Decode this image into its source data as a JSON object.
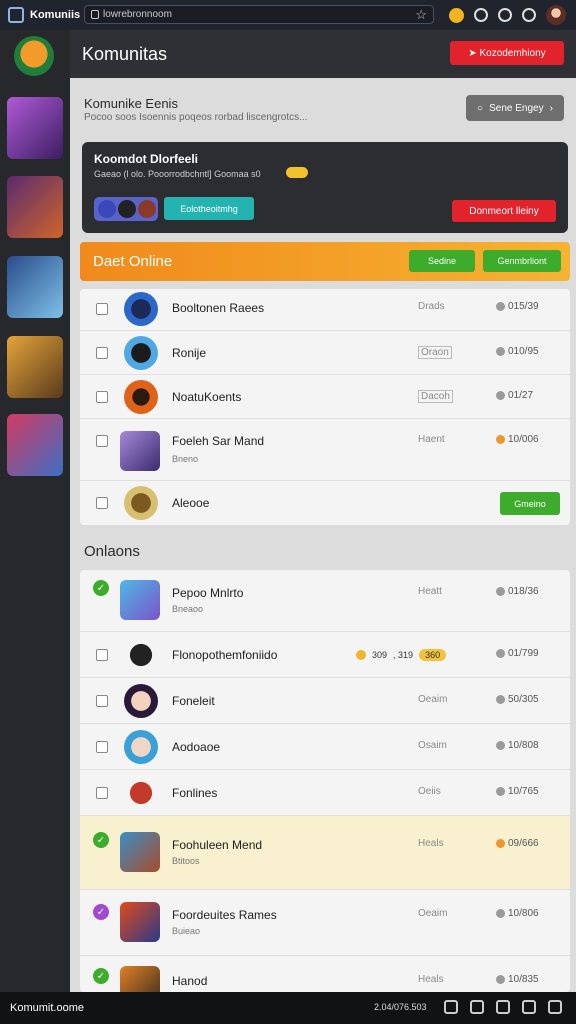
{
  "topbar": {
    "app_title": "Komuniis",
    "url": "lowrebronnoom",
    "icons": [
      "app-grid-icon",
      "star-icon",
      "coin-icon",
      "home-icon",
      "settings-icon",
      "help-icon",
      "avatar"
    ]
  },
  "header": {
    "title": "Komunitas",
    "cta_label": "Kozodemhiony"
  },
  "section1": {
    "title": "Komunike Eenis",
    "subtitle": "Pocoo soos Isoennis poqeos rorbad liscengrotcs...",
    "button_label": "Sene Engey"
  },
  "banner": {
    "title": "Koomdot Dlorfeeli",
    "subtitle": "Gaeao (l olo. Pooorrodbchntl] Goomaa s0",
    "teal_label": "Eolotheoitmhg",
    "red_label": "Donmeort lleiny"
  },
  "online_header": {
    "title": "Daet Online",
    "btn1": "Sedine",
    "btn2": "Genmbrliont"
  },
  "list1": [
    {
      "name": "Booltonen Raees",
      "status": "Drads",
      "time": "015/39"
    },
    {
      "name": "Ronije",
      "status": "Oraon",
      "time": "010/95"
    },
    {
      "name": "NoatuKoents",
      "status": "Dacoh",
      "time": "01/27"
    },
    {
      "name": "Foeleh Sar Mand",
      "sub": "Bneno",
      "status": "Haent",
      "time": "10/006"
    },
    {
      "name": "Aleooe",
      "action": "Gmeino"
    }
  ],
  "section2": {
    "title": "Onlaons"
  },
  "list2": [
    {
      "name": "Pepoo Mnlrto",
      "sub": "Bneaoo",
      "status": "Heatt",
      "time": "018/36"
    },
    {
      "name": "Flonopothemfoniido",
      "coin1": "309",
      "sep": ", 319",
      "coin2": "360",
      "time": "01/799"
    },
    {
      "name": "Foneleit",
      "status": "Oeaim",
      "time": "50/305"
    },
    {
      "name": "Aodoaoe",
      "status": "Osaim",
      "time": "10/808"
    },
    {
      "name": "Fonlines",
      "status": "Oeiis",
      "time": "10/765"
    },
    {
      "name": "Foohuleen Mend",
      "sub": "Btitoos",
      "status": "Heals",
      "time": "09/666"
    },
    {
      "name": "Foordeuites Rames",
      "sub": "Buieao",
      "status": "Oeaim",
      "time": "10/806"
    },
    {
      "name": "Hanod",
      "status": "Heals",
      "time": "10/835"
    }
  ],
  "bottombar": {
    "left": "Komumit.oome",
    "mid": "2.04/076.503"
  },
  "colors": {
    "accent_red": "#e3232c",
    "accent_green": "#3dac2c",
    "accent_orange": "#f08a1c",
    "teal": "#23b3b0"
  }
}
